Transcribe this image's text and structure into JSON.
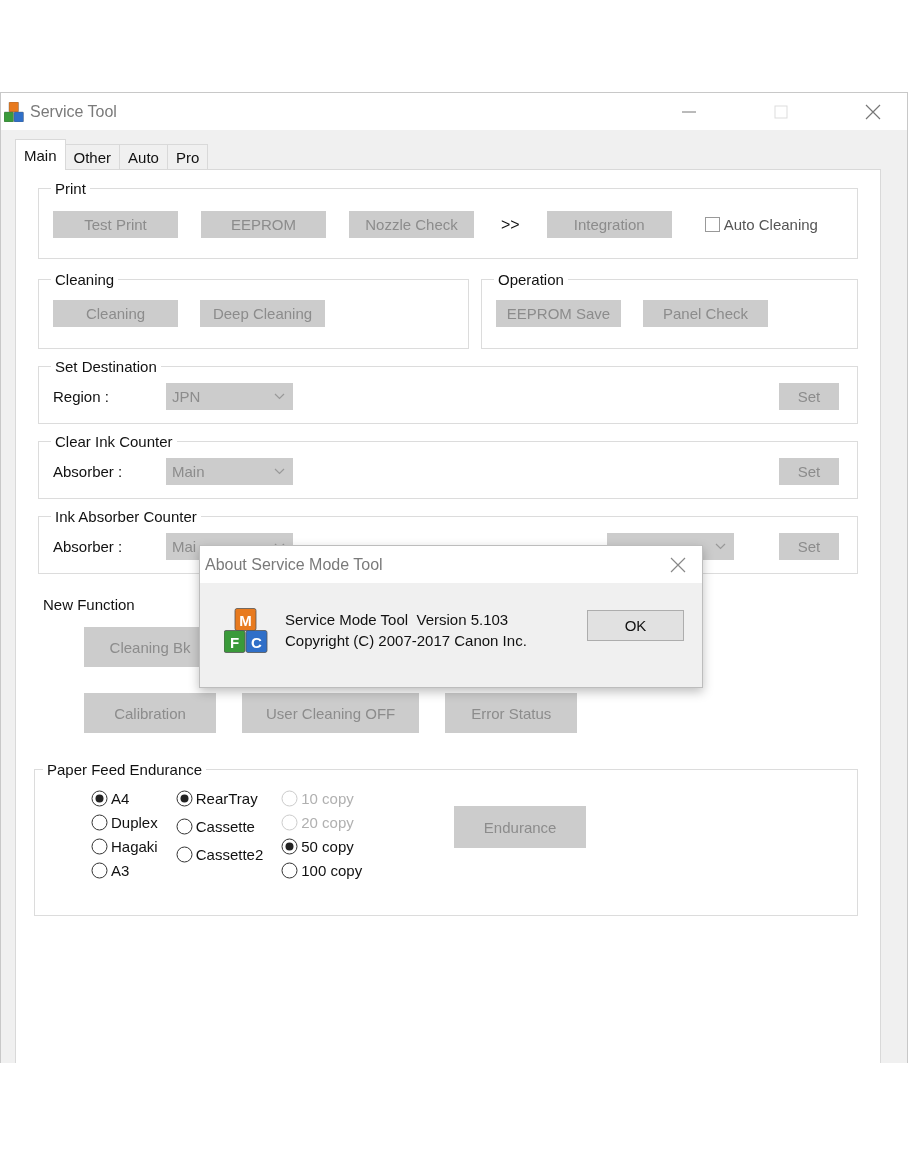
{
  "window": {
    "title": "Service Tool"
  },
  "tabs": [
    {
      "label": "Main",
      "selected": true
    },
    {
      "label": "Other",
      "selected": false
    },
    {
      "label": "Auto",
      "selected": false
    },
    {
      "label": "Pro",
      "selected": false
    }
  ],
  "print": {
    "title": "Print",
    "items": [
      {
        "kind": "button",
        "label": "Test Print",
        "disabled": true
      },
      {
        "kind": "button",
        "label": "EEPROM",
        "disabled": true
      },
      {
        "kind": "button",
        "label": "Nozzle Check",
        "disabled": true
      },
      {
        "kind": "text",
        "label": ">>"
      },
      {
        "kind": "button",
        "label": "Integration",
        "disabled": true
      },
      {
        "kind": "checkbox",
        "label": "Auto Cleaning",
        "checked": false
      }
    ]
  },
  "cleaning": {
    "title": "Cleaning",
    "buttons": [
      {
        "label": "Cleaning",
        "disabled": true
      },
      {
        "label": "Deep Cleaning",
        "disabled": true
      }
    ]
  },
  "operation": {
    "title": "Operation",
    "buttons": [
      {
        "label": "EEPROM Save",
        "disabled": true
      },
      {
        "label": "Panel Check",
        "disabled": true
      }
    ]
  },
  "setting_groups": [
    {
      "title": "Set Destination",
      "label": "Region :",
      "dropdowns": [
        {
          "value": "JPN",
          "disabled": true
        }
      ],
      "set_button": {
        "label": "Set",
        "disabled": true
      }
    },
    {
      "title": "Clear Ink Counter",
      "label": "Absorber :",
      "dropdowns": [
        {
          "value": "Main",
          "disabled": true
        }
      ],
      "set_button": {
        "label": "Set",
        "disabled": true
      }
    },
    {
      "title": "Ink Absorber Counter",
      "label": "Absorber :",
      "dropdowns": [
        {
          "value": "Mai",
          "disabled": true
        },
        {
          "disabled": true
        }
      ],
      "set_button": {
        "label": "Set",
        "disabled": true
      }
    }
  ],
  "new_function": {
    "title": "New Function",
    "rows": [
      [
        {
          "label": "Cleaning Bk",
          "disabled": true
        }
      ],
      [
        {
          "label": "Calibration",
          "disabled": true
        },
        {
          "label": "User Cleaning OFF",
          "disabled": true
        },
        {
          "label": "Error Status",
          "disabled": true
        }
      ]
    ]
  },
  "paper_feed_endurance": {
    "title": "Paper Feed Endurance",
    "radio_groups": [
      [
        {
          "label": "A4",
          "checked": true,
          "disabled": false
        },
        {
          "label": "Duplex",
          "checked": false,
          "disabled": false
        },
        {
          "label": "Hagaki",
          "checked": false,
          "disabled": false
        },
        {
          "label": "A3",
          "checked": false,
          "disabled": false
        }
      ],
      [
        {
          "label": "RearTray",
          "checked": true,
          "disabled": false
        },
        {
          "label": "Cassette",
          "checked": false,
          "disabled": false
        },
        {
          "label": "Cassette2",
          "checked": false,
          "disabled": false
        }
      ],
      [
        {
          "label": "10 copy",
          "checked": false,
          "disabled": true
        },
        {
          "label": "20 copy",
          "checked": false,
          "disabled": true
        },
        {
          "label": "50 copy",
          "checked": true,
          "disabled": false
        },
        {
          "label": "100 copy",
          "checked": false,
          "disabled": false
        }
      ]
    ],
    "button": {
      "label": "Endurance",
      "disabled": true
    }
  },
  "about_dialog": {
    "title": "About Service Mode Tool",
    "icon_letters": [
      "M",
      "F",
      "C"
    ],
    "lines": [
      "Service Mode Tool  Version 5.103",
      "Copyright (C) 2007-2017 Canon Inc."
    ],
    "ok_button": {
      "label": "OK",
      "disabled": false
    }
  }
}
